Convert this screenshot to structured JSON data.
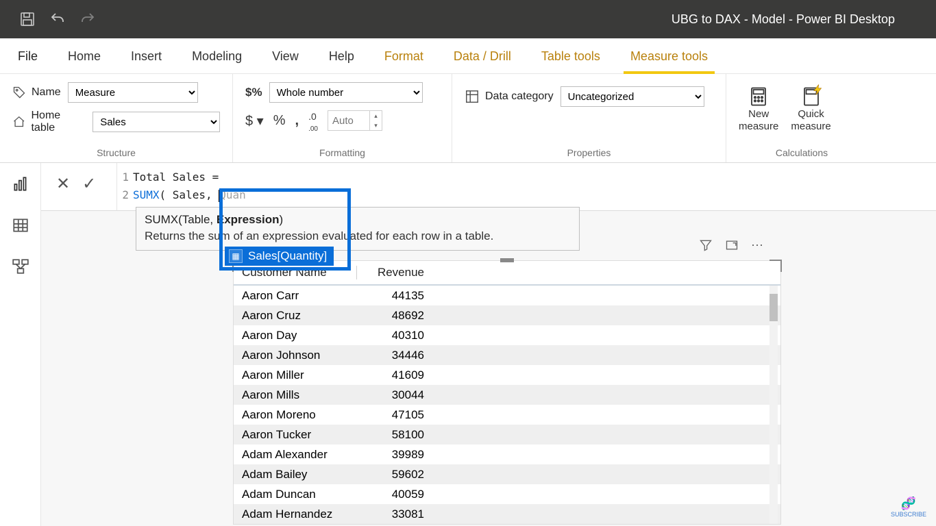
{
  "app_title": "UBG to DAX - Model - Power BI Desktop",
  "tabs": {
    "file": "File",
    "home": "Home",
    "insert": "Insert",
    "modeling": "Modeling",
    "view": "View",
    "help": "Help",
    "format": "Format",
    "datadrill": "Data / Drill",
    "tabletools": "Table tools",
    "measuretools": "Measure tools"
  },
  "structure": {
    "name_label": "Name",
    "name_value": "Measure",
    "home_label": "Home table",
    "home_value": "Sales",
    "group": "Structure"
  },
  "formatting": {
    "sel": "Whole number",
    "dollar": "$",
    "percent": "%",
    "comma": ",",
    "decbtn": ".00",
    "auto": "Auto",
    "group": "Formatting"
  },
  "properties": {
    "label": "Data category",
    "value": "Uncategorized",
    "group": "Properties"
  },
  "calculations": {
    "new": "New measure",
    "quick": "Quick measure",
    "group": "Calculations"
  },
  "editor": {
    "ln1": "1",
    "ln2": "2",
    "line1": "Total Sales =",
    "sumx": "SUMX",
    "open": "( Sales,",
    "typed": "Quan",
    "tooltip_sig_pre": "SUMX(Table, ",
    "tooltip_sig_bold": "Expression",
    "tooltip_sig_post": ")",
    "tooltip_desc": "Returns the sum of an expression evaluated for each row in a table.",
    "suggestion": "Sales[Quantity]"
  },
  "visual": {
    "col1": "Customer Name",
    "col2": "Revenue",
    "rows": [
      {
        "n": "Aaron Carr",
        "v": "44135"
      },
      {
        "n": "Aaron Cruz",
        "v": "48692"
      },
      {
        "n": "Aaron Day",
        "v": "40310"
      },
      {
        "n": "Aaron Johnson",
        "v": "34446"
      },
      {
        "n": "Aaron Miller",
        "v": "41609"
      },
      {
        "n": "Aaron Mills",
        "v": "30044"
      },
      {
        "n": "Aaron Moreno",
        "v": "47105"
      },
      {
        "n": "Aaron Tucker",
        "v": "58100"
      },
      {
        "n": "Adam Alexander",
        "v": "39989"
      },
      {
        "n": "Adam Bailey",
        "v": "59602"
      },
      {
        "n": "Adam Duncan",
        "v": "40059"
      },
      {
        "n": "Adam Hernandez",
        "v": "33081"
      }
    ]
  },
  "subscribe": "SUBSCRIBE"
}
